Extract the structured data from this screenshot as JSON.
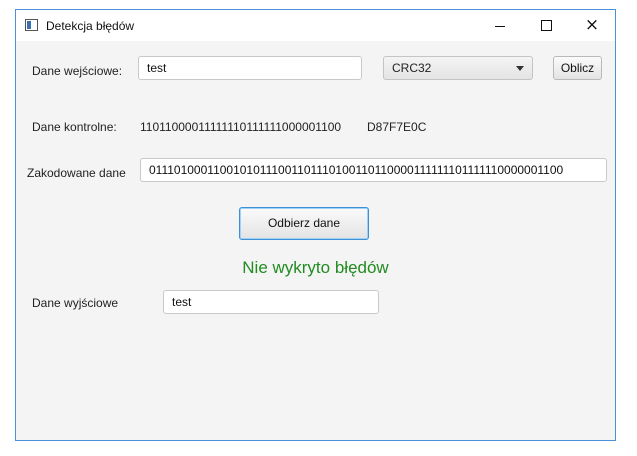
{
  "window": {
    "title": "Detekcja błędów",
    "controls": {
      "minimize": "minimize",
      "maximize": "maximize",
      "close": "×"
    }
  },
  "input": {
    "label": "Dane wejściowe:",
    "value": "test"
  },
  "algorithm": {
    "selected": "CRC32"
  },
  "compute_button": "Oblicz",
  "control": {
    "label": "Dane kontrolne:",
    "bits": "11011000011111110111111000001100",
    "hex": "D87F7E0C"
  },
  "encoded": {
    "label": "Zakodowane dane",
    "value": "01110100011001010111001101110100110110000111111101111110000001100"
  },
  "receive_button": "Odbierz dane",
  "status": {
    "text": "Nie wykryto błędów",
    "color": "#228b22"
  },
  "output": {
    "label": "Dane wyjściowe",
    "value": "test"
  }
}
